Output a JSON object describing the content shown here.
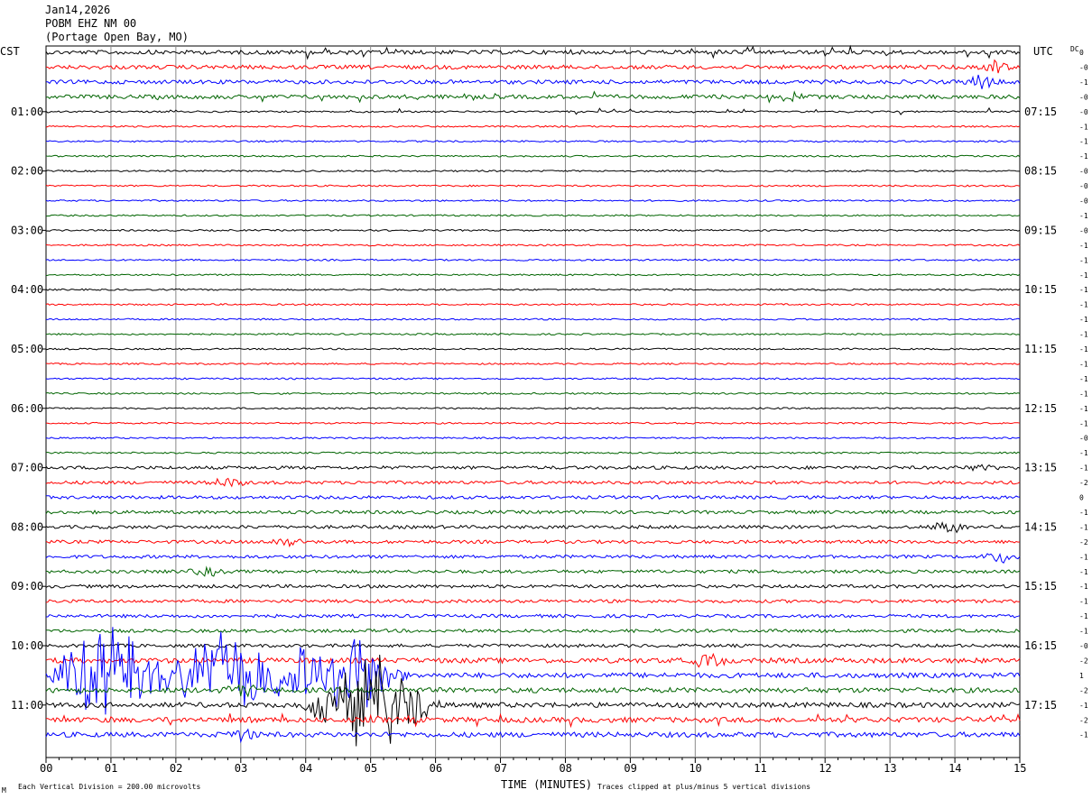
{
  "header": {
    "date": "Jan14,2026",
    "station": "POBM EHZ NM 00",
    "location": "(Portage Open Bay, MO)"
  },
  "left_zone": "CST",
  "right_zone": "UTC",
  "dc_label": "DC",
  "footer": {
    "scale_note": "Each Vertical Division =  200.00 microvolts",
    "clip_note": "Traces clipped at plus/minus 5 vertical divisions",
    "corner_mark": "M"
  },
  "chart_data": {
    "type": "line",
    "title": "",
    "xlabel": "TIME (MINUTES)",
    "ylabel": "",
    "x_ticks": [
      "00",
      "01",
      "02",
      "03",
      "04",
      "05",
      "06",
      "07",
      "08",
      "09",
      "10",
      "11",
      "12",
      "13",
      "14",
      "15"
    ],
    "xlim": [
      0,
      15
    ],
    "grid": true,
    "trace_colors": [
      "#000000",
      "#ff0000",
      "#0000ff",
      "#006400"
    ],
    "traces_per_hour": 4,
    "left_time_labels": [
      "01:00",
      "02:00",
      "03:00",
      "04:00",
      "05:00",
      "06:00",
      "07:00",
      "08:00",
      "09:00",
      "10:00",
      "11:00"
    ],
    "right_time_labels": [
      "07:15",
      "08:15",
      "09:15",
      "10:15",
      "11:15",
      "12:15",
      "13:15",
      "14:15",
      "15:15",
      "16:15",
      "17:15"
    ],
    "dc_offsets": [
      "0",
      "-0",
      "-1",
      "-0",
      "-0",
      "-1",
      "-1",
      "-1",
      "-0",
      "-0",
      "-0",
      "-1",
      "-0",
      "-1",
      "-1",
      "-1",
      "-1",
      "-1",
      "-1",
      "-1",
      "-1",
      "-1",
      "-1",
      "-1",
      "-1",
      "-1",
      "-0",
      "-1",
      "-1",
      "-2",
      "0",
      "-1",
      "-1",
      "-2",
      "-1",
      "-1",
      "-1",
      "-1",
      "-1",
      "-1",
      "-0",
      "-2",
      "1",
      "-2",
      "-1",
      "-2",
      "-1"
    ],
    "rows": 47,
    "events": [
      {
        "row": 0,
        "level": "moderate"
      },
      {
        "row": 1,
        "level": "moderate",
        "minute": 14.6
      },
      {
        "row": 2,
        "level": "moderate",
        "minute": 14.4
      },
      {
        "row": 3,
        "level": "moderate"
      },
      {
        "row": 4,
        "level": "light"
      },
      {
        "row": 28,
        "level": "light",
        "minute": 14.4
      },
      {
        "row": 29,
        "level": "light",
        "minute": 2.8
      },
      {
        "row": 32,
        "level": "moderate",
        "minute": 13.9
      },
      {
        "row": 33,
        "level": "light",
        "minute": 3.7
      },
      {
        "row": 34,
        "level": "moderate",
        "minute": 14.7
      },
      {
        "row": 35,
        "level": "light",
        "minute": 2.5
      },
      {
        "row": 41,
        "level": "moderate",
        "minute": 10.2
      },
      {
        "row": 42,
        "level": "strong",
        "minute": 1.0
      },
      {
        "row": 42,
        "level": "strong",
        "minute": 2.8
      },
      {
        "row": 42,
        "level": "strong",
        "minute": 4.5
      },
      {
        "row": 43,
        "level": "moderate",
        "minute": 3.0
      },
      {
        "row": 44,
        "level": "strong",
        "minute": 5.0
      },
      {
        "row": 45,
        "level": "moderate"
      },
      {
        "row": 46,
        "level": "moderate",
        "minute": 3.0
      }
    ]
  }
}
